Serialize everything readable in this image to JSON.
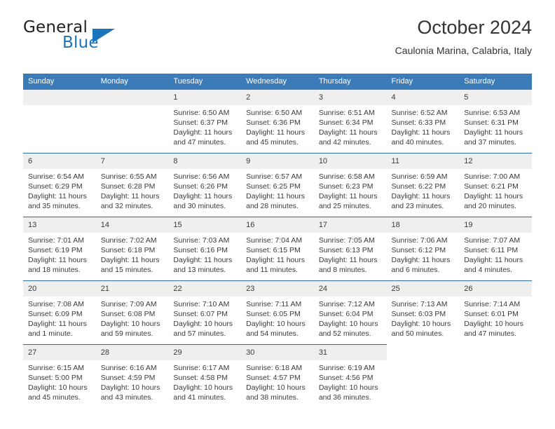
{
  "brand": {
    "word_one": "General",
    "word_two": "Blue",
    "icon": "triangle-logo"
  },
  "header": {
    "title": "October 2024",
    "subtitle": "Caulonia Marina, Calabria, Italy"
  },
  "colors": {
    "header_blue": "#3b7cb8",
    "rule_blue": "#2e6da4",
    "daynum_band": "#efefef",
    "brand_blue": "#1b75bc",
    "text": "#3a3a3a"
  },
  "weekday_headers": [
    "Sunday",
    "Monday",
    "Tuesday",
    "Wednesday",
    "Thursday",
    "Friday",
    "Saturday"
  ],
  "labels": {
    "sunrise_prefix": "Sunrise:",
    "sunset_prefix": "Sunset:",
    "daylight_prefix": "Daylight:"
  },
  "weeks": [
    [
      {
        "day": "",
        "blank": true
      },
      {
        "day": "",
        "blank": true
      },
      {
        "day": "1",
        "sunrise": "Sunrise: 6:50 AM",
        "sunset": "Sunset: 6:37 PM",
        "daylight_a": "Daylight: 11 hours",
        "daylight_b": "and 47 minutes."
      },
      {
        "day": "2",
        "sunrise": "Sunrise: 6:50 AM",
        "sunset": "Sunset: 6:36 PM",
        "daylight_a": "Daylight: 11 hours",
        "daylight_b": "and 45 minutes."
      },
      {
        "day": "3",
        "sunrise": "Sunrise: 6:51 AM",
        "sunset": "Sunset: 6:34 PM",
        "daylight_a": "Daylight: 11 hours",
        "daylight_b": "and 42 minutes."
      },
      {
        "day": "4",
        "sunrise": "Sunrise: 6:52 AM",
        "sunset": "Sunset: 6:33 PM",
        "daylight_a": "Daylight: 11 hours",
        "daylight_b": "and 40 minutes."
      },
      {
        "day": "5",
        "sunrise": "Sunrise: 6:53 AM",
        "sunset": "Sunset: 6:31 PM",
        "daylight_a": "Daylight: 11 hours",
        "daylight_b": "and 37 minutes."
      }
    ],
    [
      {
        "day": "6",
        "sunrise": "Sunrise: 6:54 AM",
        "sunset": "Sunset: 6:29 PM",
        "daylight_a": "Daylight: 11 hours",
        "daylight_b": "and 35 minutes."
      },
      {
        "day": "7",
        "sunrise": "Sunrise: 6:55 AM",
        "sunset": "Sunset: 6:28 PM",
        "daylight_a": "Daylight: 11 hours",
        "daylight_b": "and 32 minutes."
      },
      {
        "day": "8",
        "sunrise": "Sunrise: 6:56 AM",
        "sunset": "Sunset: 6:26 PM",
        "daylight_a": "Daylight: 11 hours",
        "daylight_b": "and 30 minutes."
      },
      {
        "day": "9",
        "sunrise": "Sunrise: 6:57 AM",
        "sunset": "Sunset: 6:25 PM",
        "daylight_a": "Daylight: 11 hours",
        "daylight_b": "and 28 minutes."
      },
      {
        "day": "10",
        "sunrise": "Sunrise: 6:58 AM",
        "sunset": "Sunset: 6:23 PM",
        "daylight_a": "Daylight: 11 hours",
        "daylight_b": "and 25 minutes."
      },
      {
        "day": "11",
        "sunrise": "Sunrise: 6:59 AM",
        "sunset": "Sunset: 6:22 PM",
        "daylight_a": "Daylight: 11 hours",
        "daylight_b": "and 23 minutes."
      },
      {
        "day": "12",
        "sunrise": "Sunrise: 7:00 AM",
        "sunset": "Sunset: 6:21 PM",
        "daylight_a": "Daylight: 11 hours",
        "daylight_b": "and 20 minutes."
      }
    ],
    [
      {
        "day": "13",
        "sunrise": "Sunrise: 7:01 AM",
        "sunset": "Sunset: 6:19 PM",
        "daylight_a": "Daylight: 11 hours",
        "daylight_b": "and 18 minutes."
      },
      {
        "day": "14",
        "sunrise": "Sunrise: 7:02 AM",
        "sunset": "Sunset: 6:18 PM",
        "daylight_a": "Daylight: 11 hours",
        "daylight_b": "and 15 minutes."
      },
      {
        "day": "15",
        "sunrise": "Sunrise: 7:03 AM",
        "sunset": "Sunset: 6:16 PM",
        "daylight_a": "Daylight: 11 hours",
        "daylight_b": "and 13 minutes."
      },
      {
        "day": "16",
        "sunrise": "Sunrise: 7:04 AM",
        "sunset": "Sunset: 6:15 PM",
        "daylight_a": "Daylight: 11 hours",
        "daylight_b": "and 11 minutes."
      },
      {
        "day": "17",
        "sunrise": "Sunrise: 7:05 AM",
        "sunset": "Sunset: 6:13 PM",
        "daylight_a": "Daylight: 11 hours",
        "daylight_b": "and 8 minutes."
      },
      {
        "day": "18",
        "sunrise": "Sunrise: 7:06 AM",
        "sunset": "Sunset: 6:12 PM",
        "daylight_a": "Daylight: 11 hours",
        "daylight_b": "and 6 minutes."
      },
      {
        "day": "19",
        "sunrise": "Sunrise: 7:07 AM",
        "sunset": "Sunset: 6:11 PM",
        "daylight_a": "Daylight: 11 hours",
        "daylight_b": "and 4 minutes."
      }
    ],
    [
      {
        "day": "20",
        "sunrise": "Sunrise: 7:08 AM",
        "sunset": "Sunset: 6:09 PM",
        "daylight_a": "Daylight: 11 hours",
        "daylight_b": "and 1 minute."
      },
      {
        "day": "21",
        "sunrise": "Sunrise: 7:09 AM",
        "sunset": "Sunset: 6:08 PM",
        "daylight_a": "Daylight: 10 hours",
        "daylight_b": "and 59 minutes."
      },
      {
        "day": "22",
        "sunrise": "Sunrise: 7:10 AM",
        "sunset": "Sunset: 6:07 PM",
        "daylight_a": "Daylight: 10 hours",
        "daylight_b": "and 57 minutes."
      },
      {
        "day": "23",
        "sunrise": "Sunrise: 7:11 AM",
        "sunset": "Sunset: 6:05 PM",
        "daylight_a": "Daylight: 10 hours",
        "daylight_b": "and 54 minutes."
      },
      {
        "day": "24",
        "sunrise": "Sunrise: 7:12 AM",
        "sunset": "Sunset: 6:04 PM",
        "daylight_a": "Daylight: 10 hours",
        "daylight_b": "and 52 minutes."
      },
      {
        "day": "25",
        "sunrise": "Sunrise: 7:13 AM",
        "sunset": "Sunset: 6:03 PM",
        "daylight_a": "Daylight: 10 hours",
        "daylight_b": "and 50 minutes."
      },
      {
        "day": "26",
        "sunrise": "Sunrise: 7:14 AM",
        "sunset": "Sunset: 6:01 PM",
        "daylight_a": "Daylight: 10 hours",
        "daylight_b": "and 47 minutes."
      }
    ],
    [
      {
        "day": "27",
        "sunrise": "Sunrise: 6:15 AM",
        "sunset": "Sunset: 5:00 PM",
        "daylight_a": "Daylight: 10 hours",
        "daylight_b": "and 45 minutes."
      },
      {
        "day": "28",
        "sunrise": "Sunrise: 6:16 AM",
        "sunset": "Sunset: 4:59 PM",
        "daylight_a": "Daylight: 10 hours",
        "daylight_b": "and 43 minutes."
      },
      {
        "day": "29",
        "sunrise": "Sunrise: 6:17 AM",
        "sunset": "Sunset: 4:58 PM",
        "daylight_a": "Daylight: 10 hours",
        "daylight_b": "and 41 minutes."
      },
      {
        "day": "30",
        "sunrise": "Sunrise: 6:18 AM",
        "sunset": "Sunset: 4:57 PM",
        "daylight_a": "Daylight: 10 hours",
        "daylight_b": "and 38 minutes."
      },
      {
        "day": "31",
        "sunrise": "Sunrise: 6:19 AM",
        "sunset": "Sunset: 4:56 PM",
        "daylight_a": "Daylight: 10 hours",
        "daylight_b": "and 36 minutes."
      },
      {
        "day": "",
        "blank": true,
        "tail": true
      },
      {
        "day": "",
        "blank": true,
        "tail": true
      }
    ]
  ]
}
